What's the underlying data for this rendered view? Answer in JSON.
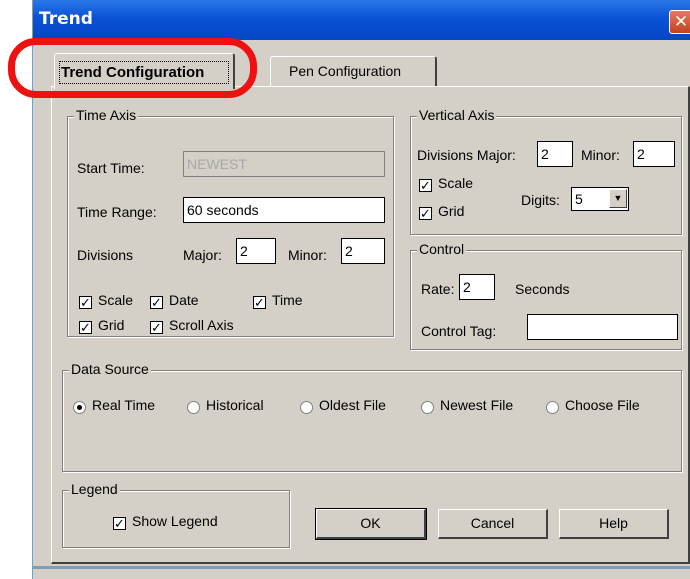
{
  "window": {
    "title": "Trend",
    "close_glyph": "✕"
  },
  "tabs": [
    {
      "label": "Trend Configuration",
      "active": true
    },
    {
      "label": "Pen Configuration",
      "active": false
    }
  ],
  "time_axis": {
    "title": "Time Axis",
    "start_time_label": "Start Time:",
    "start_time_value": "NEWEST",
    "time_range_label": "Time Range:",
    "time_range_value": "60 seconds",
    "divisions_label": "Divisions",
    "major_label": "Major:",
    "major_value": "2",
    "minor_label": "Minor:",
    "minor_value": "2",
    "checkboxes": [
      {
        "label": "Scale",
        "checked": true
      },
      {
        "label": "Date",
        "checked": true
      },
      {
        "label": "Time",
        "checked": true
      },
      {
        "label": "Grid",
        "checked": true
      },
      {
        "label": "Scroll Axis",
        "checked": true
      }
    ]
  },
  "vertical_axis": {
    "title": "Vertical Axis",
    "divisions_major_label": "Divisions Major:",
    "major_value": "2",
    "minor_label": "Minor:",
    "minor_value": "2",
    "scale_label": "Scale",
    "grid_label": "Grid",
    "digits_label": "Digits:",
    "digits_value": "5"
  },
  "control": {
    "title": "Control",
    "rate_label": "Rate:",
    "rate_value": "2",
    "seconds_label": "Seconds",
    "control_tag_label": "Control Tag:",
    "control_tag_value": ""
  },
  "data_source": {
    "title": "Data Source",
    "options": [
      "Real Time",
      "Historical",
      "Oldest File",
      "Newest File",
      "Choose File"
    ],
    "selected": "Real Time"
  },
  "legend": {
    "title": "Legend",
    "show_legend_label": "Show Legend"
  },
  "buttons": {
    "ok": "OK",
    "cancel": "Cancel",
    "help": "Help"
  },
  "check_glyph": "✓",
  "dropdown_glyph": "▼",
  "colors": {
    "title_bar": "#0a52d6",
    "highlight": "#ee1111",
    "dialog_bg": "#d4d0c8"
  }
}
